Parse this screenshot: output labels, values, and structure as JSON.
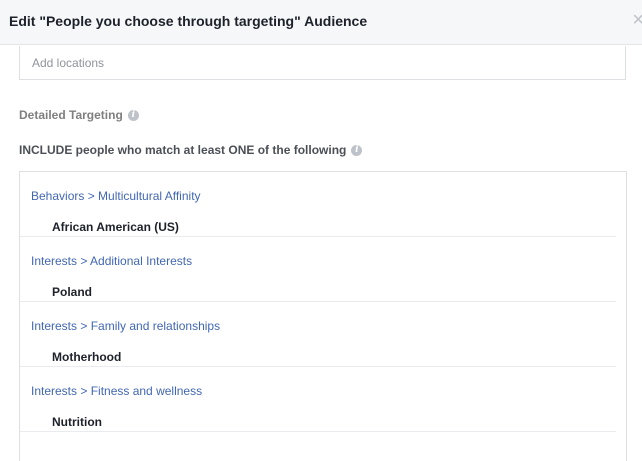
{
  "dialog": {
    "title": "Edit \"People you choose through targeting\" Audience",
    "close_icon": "×"
  },
  "locations": {
    "placeholder": "Add locations"
  },
  "detailed_targeting": {
    "label": "Detailed Targeting",
    "info_icon": "i"
  },
  "include": {
    "label": "INCLUDE people who match at least ONE of the following",
    "info_icon": "i"
  },
  "targets": [
    {
      "category": "Behaviors > Multicultural Affinity",
      "item": "African American (US)"
    },
    {
      "category": "Interests > Additional Interests",
      "item": "Poland"
    },
    {
      "category": "Interests > Family and relationships",
      "item": "Motherhood"
    },
    {
      "category": "Interests > Fitness and wellness",
      "item": "Nutrition"
    }
  ],
  "colors": {
    "link": "#4267b2",
    "header_bg": "#f6f7f9",
    "border": "#dddfe2"
  }
}
